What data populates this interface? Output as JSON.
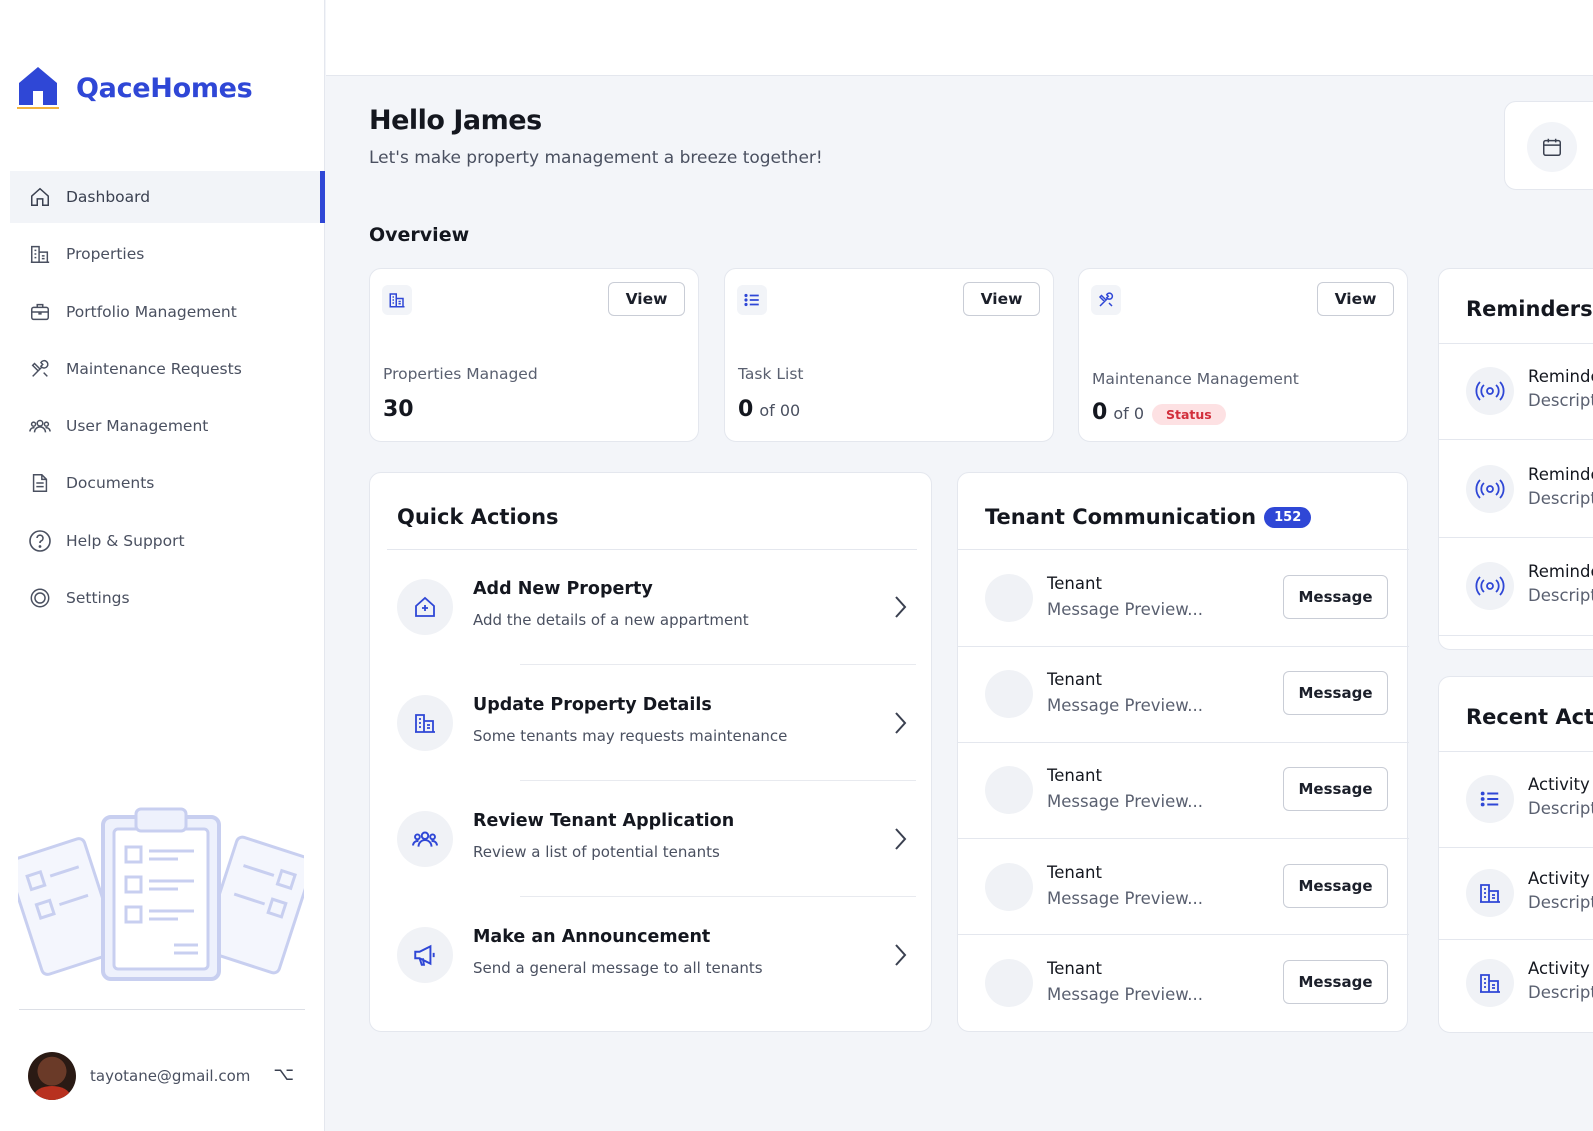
{
  "brand": {
    "name": "QaceHomes",
    "accent": "#2f47d6"
  },
  "sidebar": {
    "items": [
      {
        "label": "Dashboard",
        "icon": "home-icon",
        "active": true
      },
      {
        "label": "Properties",
        "icon": "building-icon"
      },
      {
        "label": "Portfolio Management",
        "icon": "briefcase-icon"
      },
      {
        "label": "Maintenance Requests",
        "icon": "tools-icon"
      },
      {
        "label": "User Management",
        "icon": "users-icon"
      },
      {
        "label": "Documents",
        "icon": "document-icon"
      },
      {
        "label": "Help & Support",
        "icon": "help-icon"
      },
      {
        "label": "Settings",
        "icon": "settings-icon"
      }
    ],
    "user": {
      "email": "tayotane@gmail.com",
      "toggle": "⌥"
    }
  },
  "header": {
    "title": "Hello James",
    "subtitle": "Let's make property management a breeze together!"
  },
  "overview": {
    "title": "Overview",
    "cards": [
      {
        "label": "Properties Managed",
        "value": "30",
        "view": "View",
        "icon": "building-icon"
      },
      {
        "label": "Task List",
        "value": "0",
        "of": "of 00",
        "view": "View",
        "icon": "list-icon"
      },
      {
        "label": "Maintenance Management",
        "value": "0",
        "of": "of 0",
        "status": "Status",
        "view": "View",
        "icon": "tools-icon"
      }
    ]
  },
  "quick_actions": {
    "title": "Quick Actions",
    "items": [
      {
        "title": "Add New Property",
        "desc": "Add the details of a new appartment",
        "icon": "add-home-icon"
      },
      {
        "title": "Update Property Details",
        "desc": "Some tenants may requests maintenance",
        "icon": "building-icon"
      },
      {
        "title": "Review Tenant Application",
        "desc": "Review a list of potential tenants",
        "icon": "users-icon"
      },
      {
        "title": "Make an Announcement",
        "desc": "Send a general message to all tenants",
        "icon": "megaphone-icon"
      }
    ]
  },
  "tenant_comm": {
    "title": "Tenant Communication",
    "count": "152",
    "rows": [
      {
        "name": "Tenant",
        "preview": "Message Preview...",
        "button": "Message"
      },
      {
        "name": "Tenant",
        "preview": "Message Preview...",
        "button": "Message"
      },
      {
        "name": "Tenant",
        "preview": "Message Preview...",
        "button": "Message"
      },
      {
        "name": "Tenant",
        "preview": "Message Preview...",
        "button": "Message"
      },
      {
        "name": "Tenant",
        "preview": "Message Preview...",
        "button": "Message"
      }
    ]
  },
  "reminders": {
    "title": "Reminders",
    "rows": [
      {
        "title": "Reminde",
        "desc": "Descript"
      },
      {
        "title": "Reminde",
        "desc": "Descript"
      },
      {
        "title": "Reminde",
        "desc": "Descript"
      }
    ]
  },
  "recent_activity": {
    "title": "Recent Activi",
    "rows": [
      {
        "title": "Activity",
        "desc": "Descript",
        "icon": "list-icon"
      },
      {
        "title": "Activity",
        "desc": "Descripti",
        "icon": "building-icon"
      },
      {
        "title": "Activity",
        "desc": "Descripti",
        "icon": "building-icon"
      }
    ]
  }
}
